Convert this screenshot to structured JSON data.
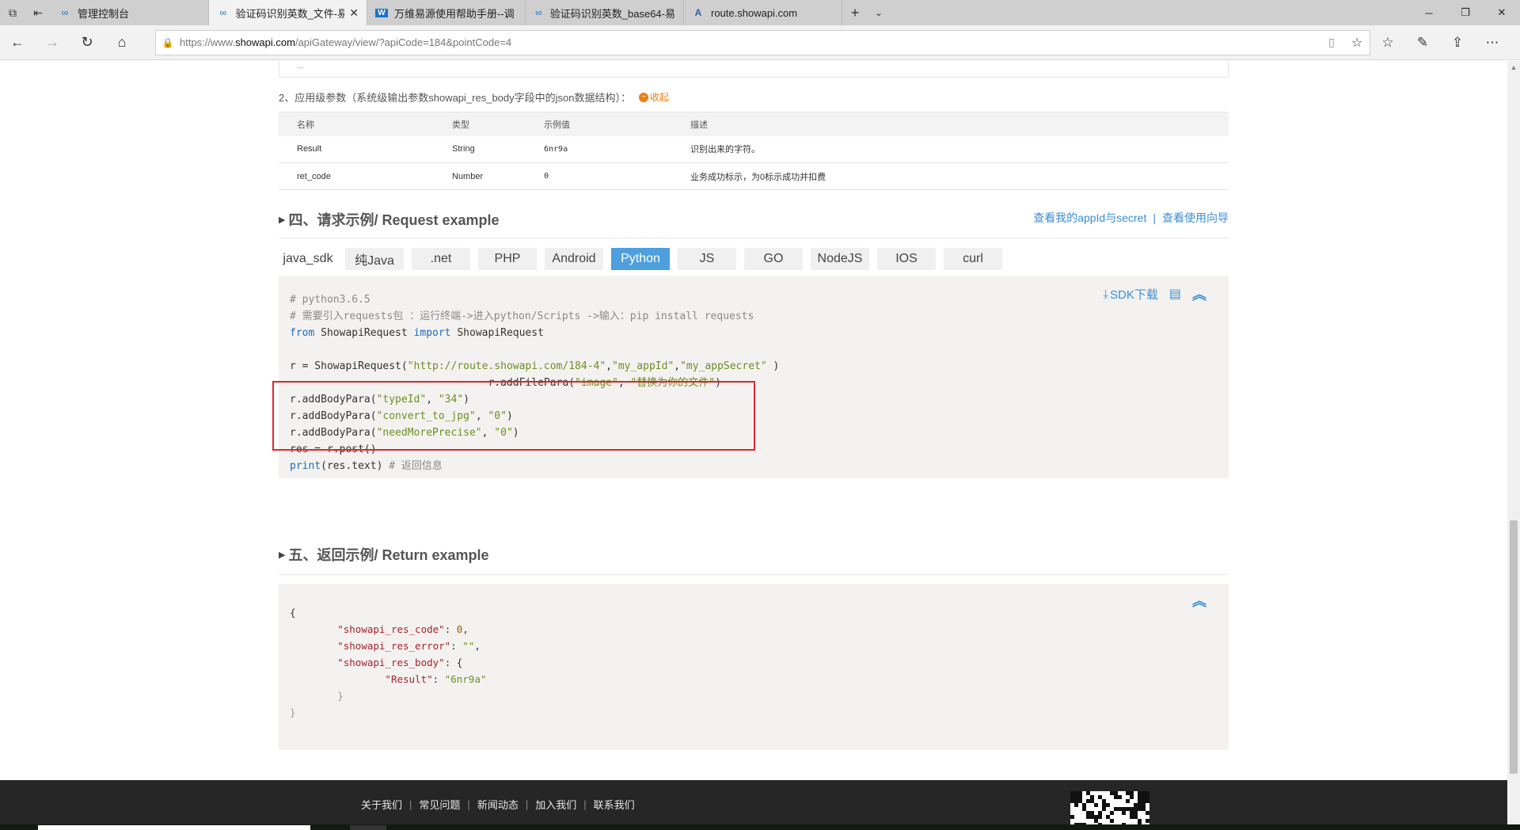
{
  "browser": {
    "tabs": [
      {
        "label": "管理控制台",
        "icon": "infinity-icon",
        "active": false
      },
      {
        "label": "验证码识别英数_文件-易",
        "icon": "infinity-icon",
        "active": true
      },
      {
        "label": "万维易源使用帮助手册--调",
        "icon": "w-logo-icon",
        "active": false
      },
      {
        "label": "验证码识别英数_base64-易",
        "icon": "infinity-icon",
        "active": false
      },
      {
        "label": "route.showapi.com",
        "icon": "a-logo-icon",
        "active": false
      }
    ],
    "url": {
      "prefix": "https://www.",
      "domain": "showapi.com",
      "path": "/apiGateway/view/?apiCode=184&pointCode=4"
    }
  },
  "page": {
    "prev_box_text": "...",
    "params_title": "2、应用级参数（系统级输出参数showapi_res_body字段中的json数据结构）：",
    "collapse_label": "收起",
    "table": {
      "headers": [
        "名称",
        "类型",
        "示例值",
        "描述"
      ],
      "rows": [
        [
          "Result",
          "String",
          "6nr9a",
          "识别出来的字符。"
        ],
        [
          "ret_code",
          "Number",
          "0",
          "业务成功标示，为0标示成功并扣费"
        ]
      ]
    },
    "request_section": {
      "title": "四、请求示例/ Request example",
      "links": [
        "查看我的appId与secret",
        "查看使用向导"
      ],
      "lang_tabs": [
        "java_sdk",
        "纯Java",
        ".net",
        "PHP",
        "Android",
        "Python",
        "JS",
        "GO",
        "NodeJS",
        "IOS",
        "curl"
      ],
      "active_tab": "Python",
      "sdk_download": "SDK下载",
      "code": {
        "l1": "# python3.6.5",
        "l2": "# 需要引入requests包 ：运行终端->进入python/Scripts ->输入：pip install requests",
        "l3_from": "from",
        "l3_mod": " ShowapiRequest ",
        "l3_import": "import",
        "l3_cls": " ShowapiRequest",
        "l5_a": "r = ShowapiRequest(",
        "l5_url": "\"http://route.showapi.com/184-4\"",
        "l5_comma1": ",",
        "l5_id": "\"my_appId\"",
        "l5_comma2": ",",
        "l5_secret": "\"my_appSecret\"",
        "l5_end": " )",
        "l6_a": "r.addFilePara(",
        "l6_k": "\"image\"",
        "l6_sep": ", ",
        "l6_v": "\"替换为你的文件\"",
        "l6_end": ")",
        "l7_a": "r.addBodyPara(",
        "l7_k": "\"typeId\"",
        "l7_sep": ", ",
        "l7_v": "\"34\"",
        "l7_end": ")",
        "l8_a": "r.addBodyPara(",
        "l8_k": "\"convert_to_jpg\"",
        "l8_sep": ", ",
        "l8_v": "\"0\"",
        "l8_end": ")",
        "l9_a": "r.addBodyPara(",
        "l9_k": "\"needMorePrecise\"",
        "l9_sep": ", ",
        "l9_v": "\"0\"",
        "l9_end": ")",
        "l10": "res = r.post()",
        "l11_print": "print",
        "l11_a": "(res.text) ",
        "l11_c": "# 返回信息"
      }
    },
    "return_section": {
      "title": "五、返回示例/ Return example",
      "code": {
        "open": "{",
        "k1": "\"showapi_res_code\"",
        "v1": "0",
        "k2": "\"showapi_res_error\"",
        "v2": "\"\"",
        "k3": "\"showapi_res_body\"",
        "k4": "\"Result\"",
        "v4": "\"6nr9a\"",
        "inner_close": "}",
        "close": "}"
      }
    },
    "footer_links": [
      "关于我们",
      "常见问题",
      "新闻动态",
      "加入我们",
      "联系我们"
    ]
  },
  "colors": {
    "accent": "#4d9fde",
    "link": "#3b8ed6",
    "highlight_box": "#e0262b",
    "collapse": "#f07d0e",
    "footer_bg": "#262626"
  }
}
